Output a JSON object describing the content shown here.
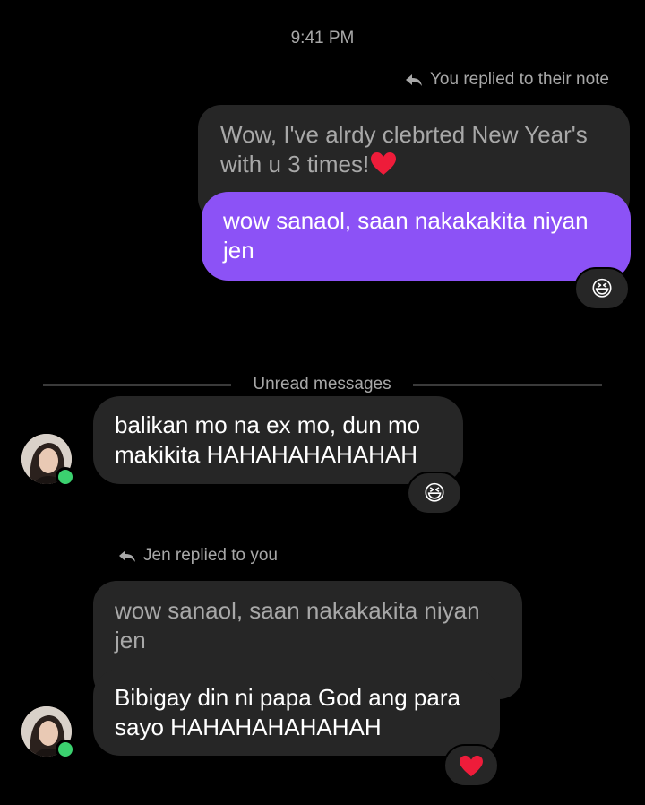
{
  "status": {
    "time": "9:41 PM"
  },
  "thread": {
    "note_reply": {
      "label": "You replied to their note",
      "quoted_text": "Wow, I've alrdy clebrted New Year's with u 3 times!",
      "message": "wow sanaol, saan nakakakita niyan jen",
      "reaction": "😆"
    },
    "divider": {
      "label": "Unread messages"
    },
    "incoming_1": {
      "text": "balikan mo na ex mo, dun mo makikita HAHAHAHAHAHAH",
      "reaction": "😆"
    },
    "incoming_reply": {
      "label": "Jen replied to you",
      "quoted_text": "wow sanaol, saan nakakakita niyan jen",
      "message": "Bibigay din ni papa God ang para sayo HAHAHAHAHAHAH",
      "reaction": "❤️"
    }
  },
  "colors": {
    "background": "#000000",
    "sent_bubble": "#8c52f6",
    "received_bubble": "#262626",
    "secondary_text": "#a8a8a8",
    "online_dot": "#3bd16f"
  },
  "icons": {
    "reply_arrow": "reply-arrow-icon",
    "heart": "heart-emoji-icon",
    "laugh": "laughing-emoji-icon"
  }
}
